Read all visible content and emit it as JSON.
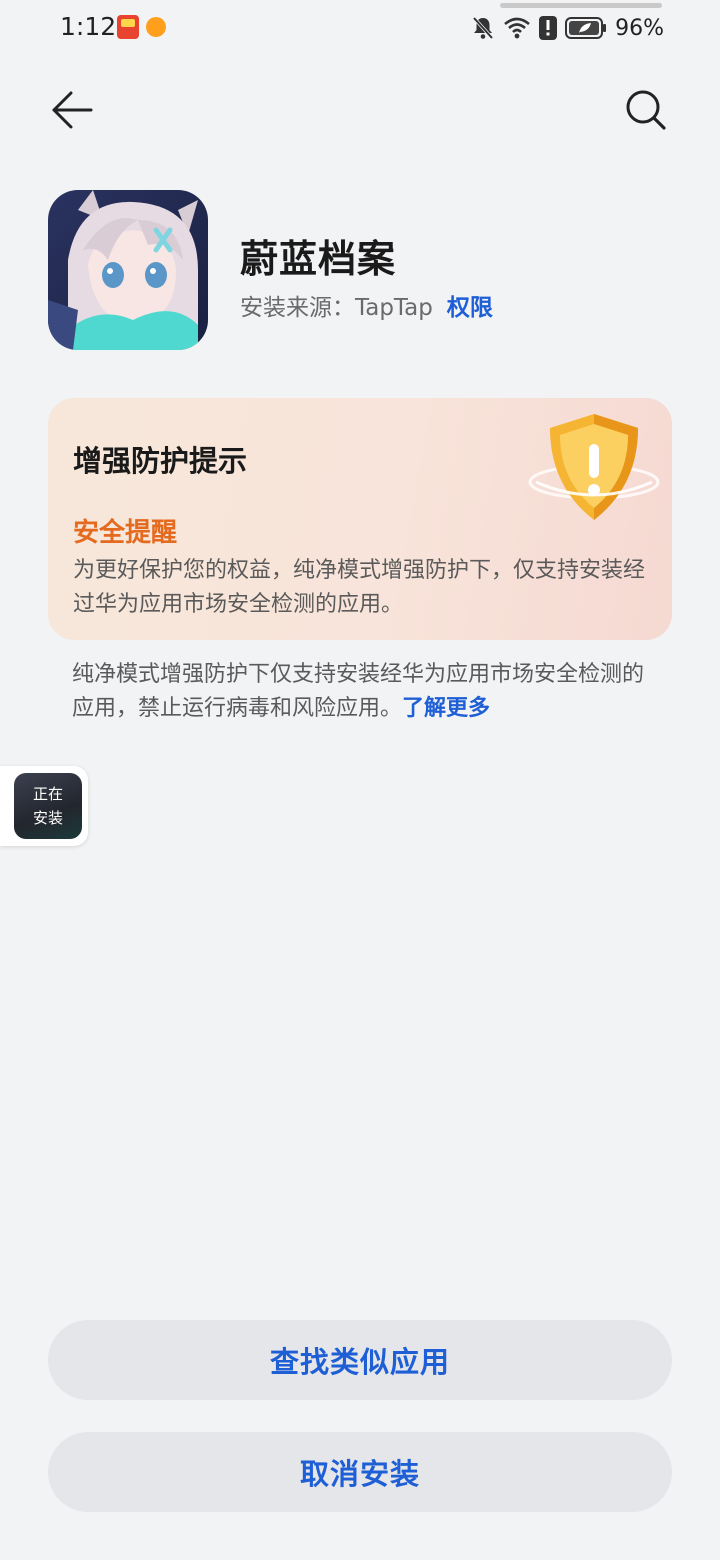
{
  "status_bar": {
    "time": "1:12",
    "battery_percent": "96%",
    "icons": [
      "notification-app-icon",
      "notification-app-icon",
      "mute-bell-icon",
      "wifi-icon",
      "alert-icon",
      "battery-icon"
    ]
  },
  "header": {
    "back_icon": "back-arrow-icon",
    "search_icon": "search-icon"
  },
  "app": {
    "name": "蔚蓝档案",
    "source_label": "安装来源：TapTap",
    "permissions_link": "权限"
  },
  "warning_card": {
    "title": "增强防护提示",
    "subtitle": "安全提醒",
    "body": "为更好保护您的权益，纯净模式增强防护下，仅支持安装经过华为应用市场安全检测的应用。"
  },
  "info": {
    "text": "纯净模式增强防护下仅支持安装经华为应用市场安全检测的应用，禁止运行病毒和风险应用。",
    "learn_more": "了解更多"
  },
  "installing_bubble": {
    "label": "正在安装"
  },
  "buttons": {
    "find_similar": "查找类似应用",
    "cancel_install": "取消安装"
  },
  "colors": {
    "background": "#f1f3f5",
    "accent_blue": "#1f5fd6",
    "warning_orange": "#e46a1f"
  }
}
